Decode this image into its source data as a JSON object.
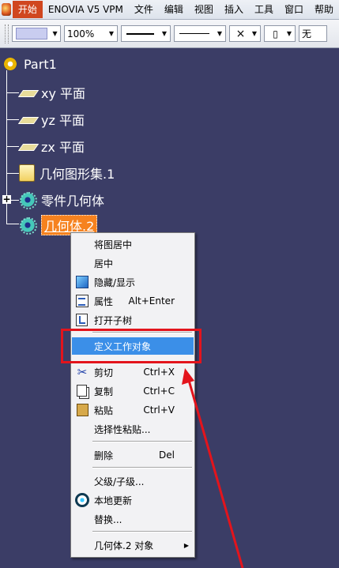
{
  "menubar": {
    "items": [
      {
        "label": "开始",
        "active": true
      },
      {
        "label": "ENOVIA V5 VPM"
      },
      {
        "label": "文件"
      },
      {
        "label": "编辑"
      },
      {
        "label": "视图"
      },
      {
        "label": "插入"
      },
      {
        "label": "工具"
      },
      {
        "label": "窗口"
      },
      {
        "label": "帮助"
      }
    ]
  },
  "toolbar": {
    "zoom_value": "100%",
    "layer_value": "无"
  },
  "tree": {
    "root": "Part1",
    "xy_plane": "xy 平面",
    "yz_plane": "yz 平面",
    "zx_plane": "zx 平面",
    "geo_set": "几何图形集.1",
    "part_body": "零件几何体",
    "body2": "几何体.2"
  },
  "context_menu": {
    "center_graph": "将图居中",
    "center": "居中",
    "hide_show": "隐藏/显示",
    "properties": "属性",
    "properties_shortcut": "Alt+Enter",
    "open_subtree": "打开子树",
    "define_work_object": "定义工作对象",
    "cut": "剪切",
    "cut_shortcut": "Ctrl+X",
    "copy": "复制",
    "copy_shortcut": "Ctrl+C",
    "paste": "粘贴",
    "paste_shortcut": "Ctrl+V",
    "paste_special": "选择性粘贴...",
    "delete": "删除",
    "delete_shortcut": "Del",
    "parent_child": "父级/子级...",
    "local_update": "本地更新",
    "replace": "替换...",
    "object_submenu": "几何体.2 对象"
  },
  "colors": {
    "background": "#3b3d66",
    "highlight": "#3b8fe8",
    "selection": "#f6821f",
    "annotation_red": "#e3141c"
  }
}
